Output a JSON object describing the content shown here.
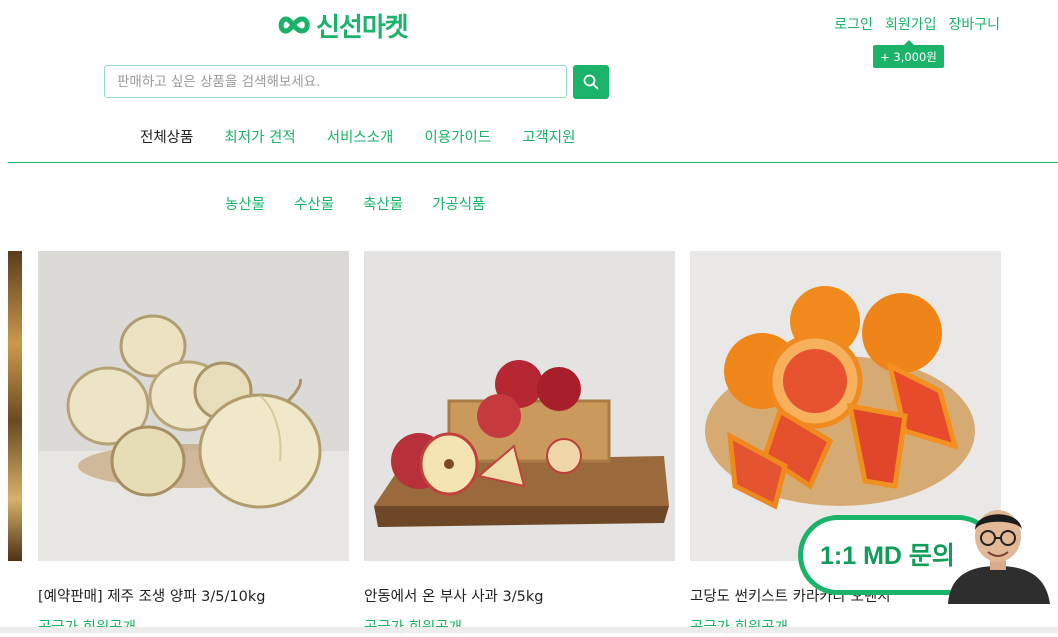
{
  "brand": {
    "name": "신선마켓",
    "color": "#1bb36a"
  },
  "header": {
    "login": "로그인",
    "signup": "회원가입",
    "cart": "장바구니",
    "signup_bonus": "+ 3,000원"
  },
  "search": {
    "placeholder": "판매하고 싶은 상품을 검색해보세요.",
    "icon": "search-icon"
  },
  "main_nav": [
    "전체상품",
    "최저가 견적",
    "서비스소개",
    "이용가이드",
    "고객지원"
  ],
  "sub_nav": [
    "농산물",
    "수산물",
    "축산물",
    "가공식품"
  ],
  "products": [
    {
      "name": "[예약판매] 제주 조생 양파 3/5/10kg",
      "price": "공급가 회원공개"
    },
    {
      "name": "안동에서 온 부사 사과 3/5kg",
      "price": "공급가 회원공개"
    },
    {
      "name": "고당도 썬키스트 카라카라 오렌지",
      "price": "공급가 회원공개"
    }
  ],
  "md_chat": {
    "label": "1:1 MD 문의"
  }
}
